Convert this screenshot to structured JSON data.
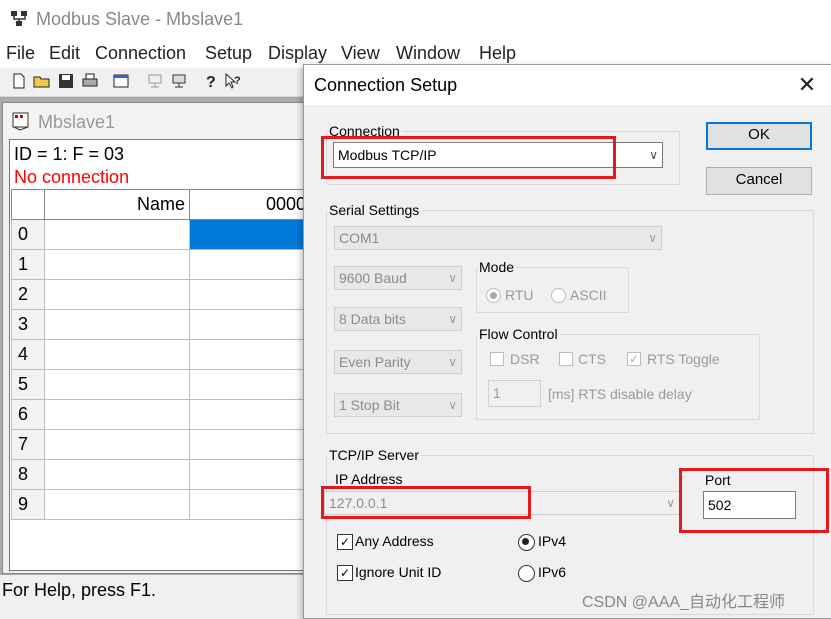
{
  "app": {
    "title": "Modbus Slave - Mbslave1",
    "menu": [
      "File",
      "Edit",
      "Connection",
      "Setup",
      "Display",
      "View",
      "Window",
      "Help"
    ]
  },
  "child": {
    "title": "Mbslave1",
    "id_line": "ID = 1: F = 03",
    "status": "No connection",
    "grid": {
      "headers": [
        "Name",
        "0000"
      ],
      "rows": [
        "0",
        "1",
        "2",
        "3",
        "4",
        "5",
        "6",
        "7",
        "8",
        "9"
      ]
    }
  },
  "statusbar": {
    "text": "For Help, press F1."
  },
  "dialog": {
    "title": "Connection Setup",
    "close": "✕",
    "connection": {
      "label": "Connection",
      "value": "Modbus TCP/IP"
    },
    "ok": "OK",
    "cancel": "Cancel",
    "serial": {
      "label": "Serial Settings",
      "port": "COM1",
      "baud": "9600 Baud",
      "data_bits": "8 Data bits",
      "parity": "Even Parity",
      "stop_bits": "1 Stop Bit",
      "mode": {
        "label": "Mode",
        "rtu": "RTU",
        "ascii": "ASCII"
      },
      "flow": {
        "label": "Flow Control",
        "dsr": "DSR",
        "cts": "CTS",
        "rts_toggle": "RTS Toggle",
        "delay_value": "1",
        "delay_label": "[ms] RTS disable delay"
      }
    },
    "tcp": {
      "label": "TCP/IP Server",
      "ip_label": "IP Address",
      "ip_value": "127.0.0.1",
      "port_label": "Port",
      "port_value": "502",
      "any_address": "Any Address",
      "ignore_unit": "Ignore Unit ID",
      "ipv4": "IPv4",
      "ipv6": "IPv6"
    }
  },
  "watermark": "CSDN @AAA_自动化工程师",
  "colors": {
    "highlight": "#e21a1a",
    "selection": "#0078d7",
    "error": "#ff0000"
  }
}
